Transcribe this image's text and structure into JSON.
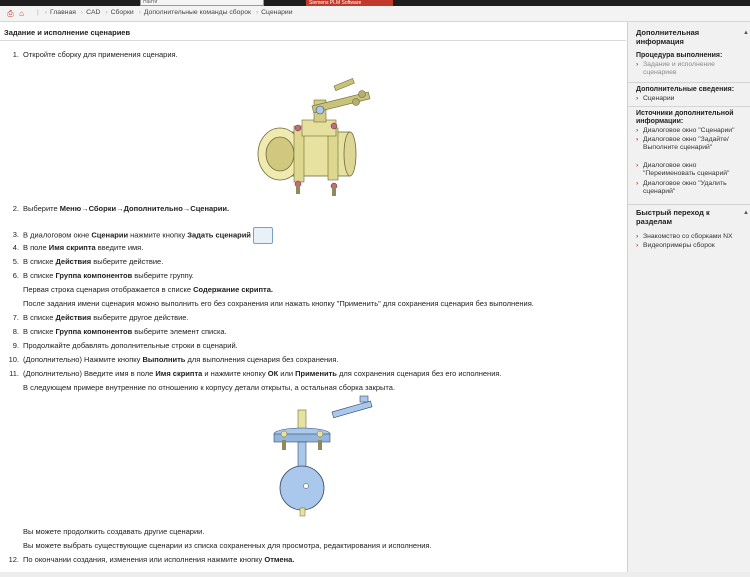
{
  "topbar": {
    "search_value": "Найти",
    "tab_label": "Siemens PLM Software"
  },
  "breadcrumb": {
    "items": [
      "Главная",
      "CAD",
      "Сборки",
      "Дополнительные команды сборок",
      "Сценарии"
    ]
  },
  "main": {
    "title": "Задание и исполнение сценариев",
    "steps": {
      "s1": "Откройте сборку для применения сценария.",
      "s2_a": "Выберите ",
      "s2_b": "Меню",
      "s2_c": "→",
      "s2_d": "Сборки",
      "s2_e": "→",
      "s2_f": "Дополнительно",
      "s2_g": "→",
      "s2_h": "Сценарии.",
      "s3_a": "В диалоговом окне ",
      "s3_b": "Сценарии",
      "s3_c": " нажмите кнопку ",
      "s3_d": "Задать сценарий",
      "s4_a": "В поле ",
      "s4_b": "Имя скрипта",
      "s4_c": " введите имя.",
      "s5_a": "В списке ",
      "s5_b": "Действия",
      "s5_c": " выберите действие.",
      "s6_a": "В списке ",
      "s6_b": "Группа компонентов",
      "s6_c": " выберите группу.",
      "s6_sub1_a": "Первая строка сценария отображается в списке ",
      "s6_sub1_b": "Содержание скрипта.",
      "s6_sub2": "После задания имени сценария можно выполнить его без сохранения или нажать кнопку \"Применить\" для сохранения сценария без выполнения.",
      "s7_a": "В списке ",
      "s7_b": "Действия",
      "s7_c": " выберите другое действие.",
      "s8_a": "В списке ",
      "s8_b": "Группа компонентов",
      "s8_c": " выберите элемент списка.",
      "s9": "Продолжайте добавлять дополнительные строки в сценарий.",
      "s10_a": "(Дополнительно) Нажмите кнопку ",
      "s10_b": "Выполнить",
      "s10_c": " для выполнения сценария без сохранения.",
      "s11_a": "(Дополнительно) Введите имя в поле ",
      "s11_b": "Имя скрипта",
      "s11_c": " и нажмите кнопку ",
      "s11_d": "ОК",
      "s11_e": " или ",
      "s11_f": "Применить",
      "s11_g": " для сохранения сценария без его исполнения.",
      "s11_sub": "В следующем примере внутренние по отношению к корпусу детали открыты, а остальная сборка закрыта.",
      "s11_sub2": "Вы можете продолжить создавать другие сценарии.",
      "s11_sub3": "Вы можете выбрать существующие сценарии из списка сохраненных для просмотра, редактирования и исполнения.",
      "s12_a": "По окончании создания, изменения или исполнения нажмите кнопку ",
      "s12_b": "Отмена."
    },
    "numbers": [
      "1.",
      "2.",
      "3.",
      "4.",
      "5.",
      "6.",
      "7.",
      "8.",
      "9.",
      "10.",
      "11.",
      "12."
    ]
  },
  "sidebar": {
    "section1_title": "Дополнительная информация",
    "procedure_label": "Процедура выполнения:",
    "procedure_link": "Задание и исполнение сценариев",
    "additional_label": "Дополнительные сведения:",
    "additional_link": "Сценарии",
    "sources_label": "Источники дополнительной информации:",
    "sources_links": [
      "Диалоговое окно \"Сценарии\"",
      "Диалоговое окно \"Задайте/Выполните сценарий\"",
      "Диалоговое окно \"Переименовать сценарий\"",
      "Диалоговое окно \"Удалить сценарий\""
    ],
    "section2_title": "Быстрый переход к разделам",
    "quick_links": [
      "Знакомство со сборками NX",
      "Видеопримеры сборок"
    ]
  },
  "colors": {
    "accent": "#c0392b",
    "sidebar_bg": "#f1f1f1",
    "pipe": "#e8e2a0",
    "disc": "#a9c8ec"
  }
}
